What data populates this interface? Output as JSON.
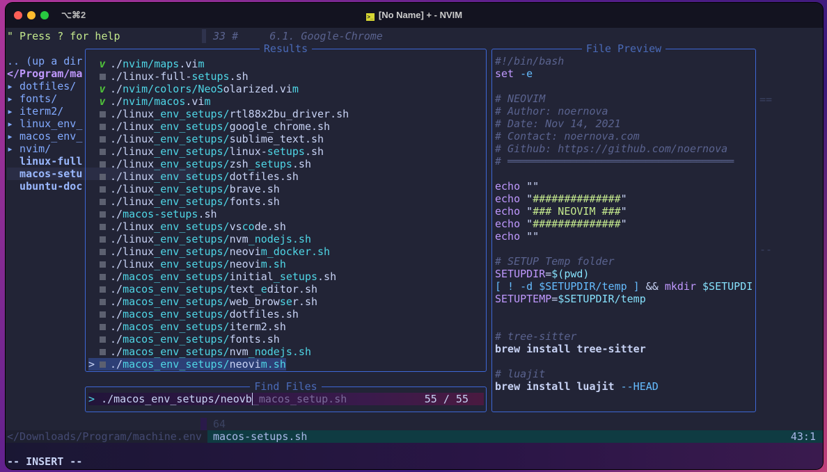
{
  "titlebar": {
    "shortcut": "⌥⌘2",
    "title": "[No Name] + - NVIM",
    "icon": "terminal-icon"
  },
  "help_line": "\" Press ? for help",
  "top_code_line": "33 #     6.1. Google-Chrome",
  "tree": [
    {
      "text": ".. (up a dir",
      "kind": "up"
    },
    {
      "text": "</Program/ma",
      "kind": "root"
    },
    {
      "text": "▸ dotfiles/",
      "kind": "dir"
    },
    {
      "text": "▸ fonts/",
      "kind": "dir"
    },
    {
      "text": "▸ iterm2/",
      "kind": "dir"
    },
    {
      "text": "▸ linux_env_",
      "kind": "dir"
    },
    {
      "text": "▸ macos_env_",
      "kind": "dir"
    },
    {
      "text": "▸ nvim/",
      "kind": "dir"
    },
    {
      "text": "  linux-full",
      "kind": "file"
    },
    {
      "text": "  macos-setu",
      "kind": "file",
      "current": true
    },
    {
      "text": "  ubuntu-doc",
      "kind": "file"
    }
  ],
  "results": {
    "title": "Results",
    "items": [
      {
        "icon": "vim",
        "parts": [
          "./",
          "nvim/maps",
          ".vi",
          "m"
        ]
      },
      {
        "icon": "sh",
        "parts": [
          "./linux-full-",
          "setups",
          ".sh"
        ]
      },
      {
        "icon": "vim",
        "parts": [
          "./",
          "nvim/colors/NeoS",
          "olarized.vi",
          "m"
        ]
      },
      {
        "icon": "vim",
        "parts": [
          "./",
          "nvim/macos",
          ".vi",
          "m"
        ]
      },
      {
        "icon": "sh",
        "parts": [
          "./linux",
          "_env_setups/",
          "rtl88x2bu_driver.sh"
        ]
      },
      {
        "icon": "sh",
        "parts": [
          "./linux",
          "_env_setups/",
          "google_chrome.sh"
        ]
      },
      {
        "icon": "sh",
        "parts": [
          "./linux",
          "_env_setups/",
          "sublime_text.sh"
        ]
      },
      {
        "icon": "sh",
        "parts": [
          "./linux",
          "_env_setups/",
          "linux-",
          "setups",
          ".sh"
        ]
      },
      {
        "icon": "sh",
        "parts": [
          "./linux",
          "_env_setups/",
          "zsh",
          "_setups",
          ".sh"
        ]
      },
      {
        "icon": "sh",
        "parts": [
          "./linux",
          "_env_setups/",
          "dotfiles.sh"
        ]
      },
      {
        "icon": "sh",
        "parts": [
          "./linux",
          "_env_setups/",
          "brave.sh"
        ]
      },
      {
        "icon": "sh",
        "parts": [
          "./linux",
          "_env_setups/",
          "fonts.sh"
        ]
      },
      {
        "icon": "sh",
        "parts": [
          "./",
          "macos-setups",
          ".sh"
        ]
      },
      {
        "icon": "sh",
        "parts": [
          "./linux",
          "_env_setups/",
          "vs",
          "co",
          "de.sh"
        ]
      },
      {
        "icon": "sh",
        "parts": [
          "./linux",
          "_env_setups/",
          "nvm",
          "_nodejs.sh"
        ]
      },
      {
        "icon": "sh",
        "parts": [
          "./linux",
          "_env_setups/",
          "neovi",
          "m_docker.sh"
        ]
      },
      {
        "icon": "sh",
        "parts": [
          "./linux",
          "_env_setups/",
          "neovi",
          "m.sh"
        ]
      },
      {
        "icon": "sh",
        "parts": [
          "./",
          "macos_env_setups/",
          "initial",
          "_setups",
          ".sh"
        ]
      },
      {
        "icon": "sh",
        "parts": [
          "./",
          "macos_env_setups/",
          "text_",
          "e",
          "ditor.sh"
        ]
      },
      {
        "icon": "sh",
        "parts": [
          "./",
          "macos_env_setups/",
          "web_brow",
          "se",
          "r.sh"
        ]
      },
      {
        "icon": "sh",
        "parts": [
          "./",
          "macos_env_setups/",
          "dotfiles.sh"
        ]
      },
      {
        "icon": "sh",
        "parts": [
          "./",
          "macos_env_setups/",
          "iterm2.sh"
        ]
      },
      {
        "icon": "sh",
        "parts": [
          "./",
          "macos_env_setups/",
          "fonts.sh"
        ]
      },
      {
        "icon": "sh",
        "parts": [
          "./",
          "macos_env_setups/",
          "nvm",
          "_nodejs.sh"
        ]
      },
      {
        "icon": "sh",
        "parts": [
          "./",
          "macos_env_setups/",
          "neovi",
          "m.sh"
        ],
        "selected": true
      }
    ]
  },
  "find": {
    "title": "Find Files",
    "prompt": ">",
    "query": "./macos_env_setups/neovb",
    "ghost": "_macos_setup.sh",
    "count": "55 / 55"
  },
  "preview": {
    "title": "File Preview",
    "lines": [
      [
        [
          "m",
          "#!/bin/bash"
        ]
      ],
      [
        [
          "k",
          "set "
        ],
        [
          "cy",
          "-e"
        ]
      ],
      [],
      [
        [
          "m",
          "# NEOVIM"
        ]
      ],
      [
        [
          "m",
          "# Author: noernova"
        ]
      ],
      [
        [
          "m",
          "# Date: Nov 14, 2021"
        ]
      ],
      [
        [
          "m",
          "# Contact: noernova.com"
        ]
      ],
      [
        [
          "m",
          "# Github: https://github.com/noernova"
        ]
      ],
      [
        [
          "m",
          "# ════════════════════════════════════"
        ]
      ],
      [],
      [
        [
          "k",
          "echo "
        ],
        [
          "w",
          "\"\""
        ]
      ],
      [
        [
          "k",
          "echo "
        ],
        [
          "w",
          "\""
        ],
        [
          "s",
          "##############"
        ],
        [
          "w",
          "\""
        ]
      ],
      [
        [
          "k",
          "echo "
        ],
        [
          "w",
          "\""
        ],
        [
          "s",
          "### NEOVIM ###"
        ],
        [
          "w",
          "\""
        ]
      ],
      [
        [
          "k",
          "echo "
        ],
        [
          "w",
          "\""
        ],
        [
          "s",
          "##############"
        ],
        [
          "w",
          "\""
        ]
      ],
      [
        [
          "k",
          "echo "
        ],
        [
          "w",
          "\"\""
        ]
      ],
      [],
      [
        [
          "m",
          "# SETUP Temp folder"
        ]
      ],
      [
        [
          "k",
          "SETUPDIR"
        ],
        [
          "w",
          "="
        ],
        [
          "cyb",
          "$(pwd)"
        ]
      ],
      [
        [
          "cy",
          "[ ! -d $SETUPDIR/temp ] "
        ],
        [
          "w",
          "&& "
        ],
        [
          "k",
          "mkdir "
        ],
        [
          "cyb",
          "$SETUPDI"
        ]
      ],
      [
        [
          "k",
          "SETUPTEMP"
        ],
        [
          "w",
          "="
        ],
        [
          "cyb",
          "$SETUPDIR/temp"
        ]
      ],
      [],
      [],
      [
        [
          "m",
          "# tree-sitter"
        ]
      ],
      [
        [
          "w",
          "brew install tree-sitter"
        ]
      ],
      [],
      [
        [
          "m",
          "# luajit"
        ]
      ],
      [
        [
          "w",
          "brew install luajit "
        ],
        [
          "cy",
          "--HEAD"
        ]
      ]
    ]
  },
  "gutter_marks": [
    "==",
    "--"
  ],
  "bottom_line_number": "64",
  "statusline": {
    "left": "</Downloads/Program/machine.env",
    "file": "macos-setups.sh",
    "position": "43:1"
  },
  "mode": "-- INSERT --"
}
